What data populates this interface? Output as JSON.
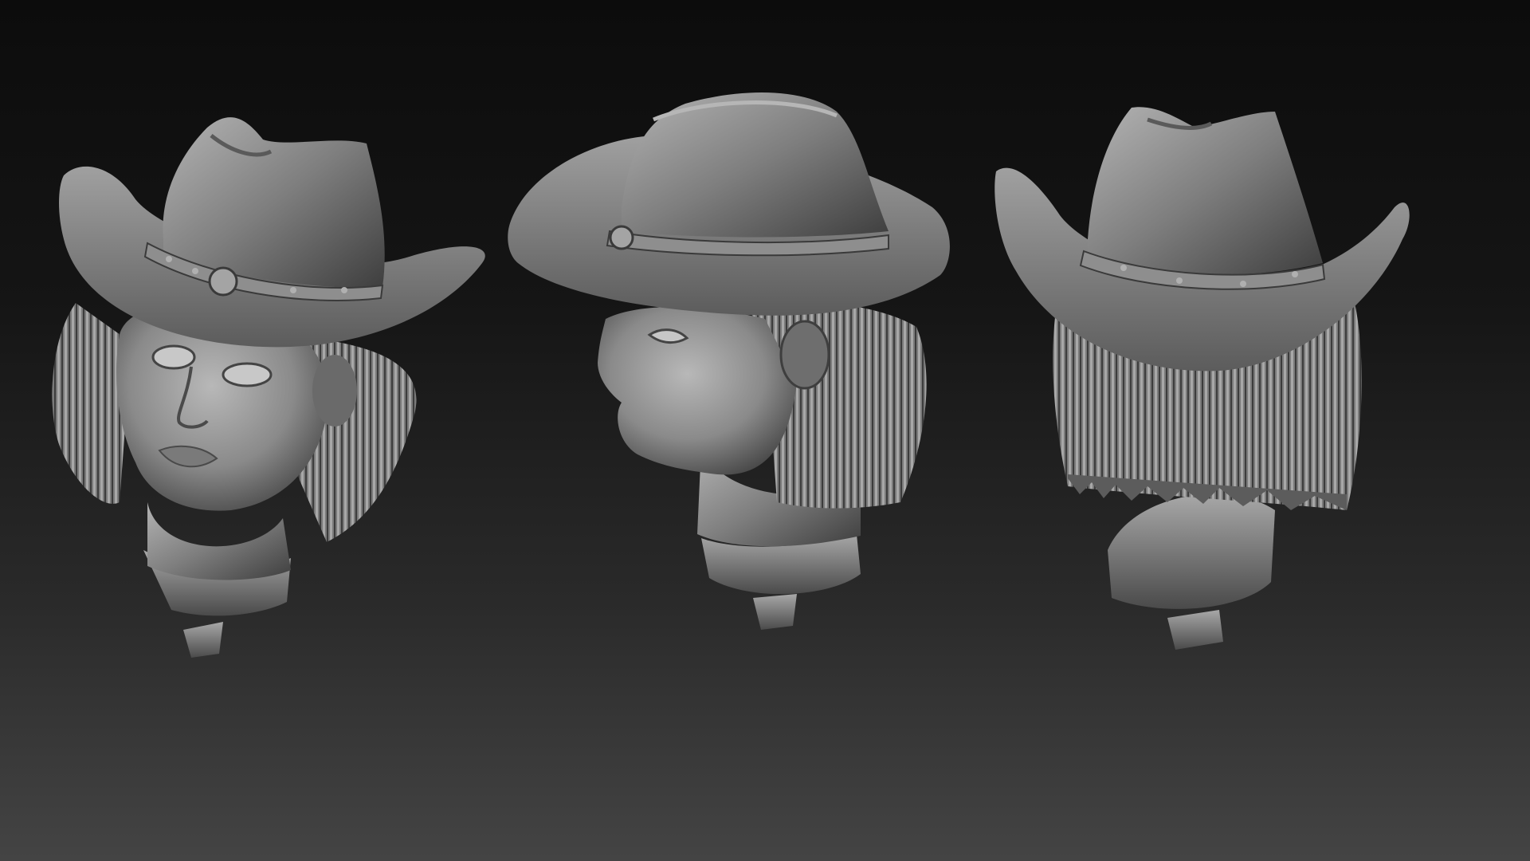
{
  "scene": {
    "background_top": "#0c0c0c",
    "background_bottom": "#444444",
    "clay_light": "#9a9a9a",
    "clay_mid": "#6e6e6e",
    "clay_dark": "#3a3a3a",
    "models": [
      {
        "view": "front-three-quarter"
      },
      {
        "view": "side-profile"
      },
      {
        "view": "back"
      }
    ]
  }
}
